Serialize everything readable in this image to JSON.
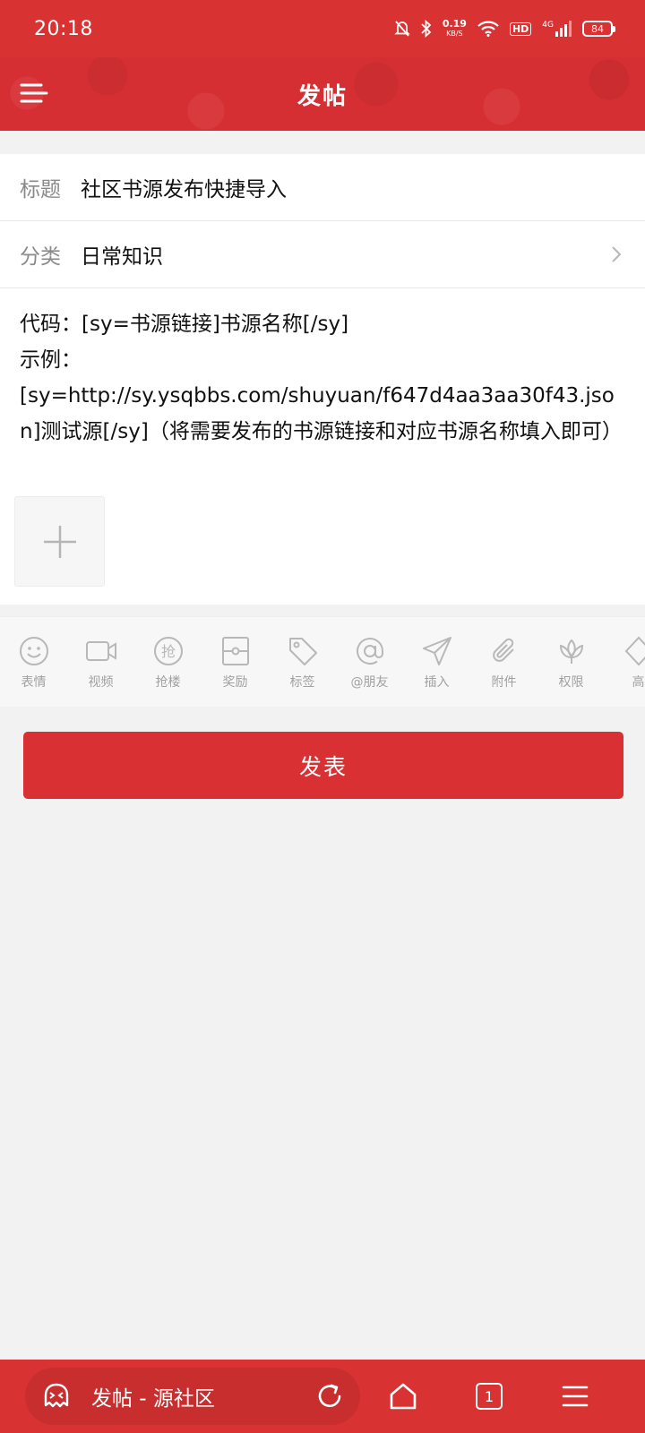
{
  "status_bar": {
    "time": "20:18",
    "net_speed": "0.19",
    "net_unit": "KB/S",
    "hd_label": "HD",
    "signal_label": "4G",
    "battery": "84"
  },
  "header": {
    "title": "发帖"
  },
  "form": {
    "title_label": "标题",
    "title_value": "社区书源发布快捷导入",
    "category_label": "分类",
    "category_value": "日常知识",
    "content": "代码：[sy=书源链接]书源名称[/sy]\n示例：\n[sy=http://sy.ysqbbs.com/shuyuan/f647d4aa3aa30f43.json]测试源[/sy]（将需要发布的书源链接和对应书源名称填入即可）"
  },
  "toolbar": {
    "items": [
      {
        "label": "表情",
        "icon": "smile-icon"
      },
      {
        "label": "视频",
        "icon": "video-icon"
      },
      {
        "label": "抢楼",
        "icon": "grab-floor-icon"
      },
      {
        "label": "奖励",
        "icon": "reward-icon"
      },
      {
        "label": "标签",
        "icon": "tag-icon"
      },
      {
        "label": "@朋友",
        "icon": "at-icon"
      },
      {
        "label": "插入",
        "icon": "send-icon"
      },
      {
        "label": "附件",
        "icon": "paperclip-icon"
      },
      {
        "label": "权限",
        "icon": "lotus-icon"
      },
      {
        "label": "高",
        "icon": "diamond-icon"
      }
    ]
  },
  "publish": {
    "label": "发表"
  },
  "bottom_nav": {
    "page_title": "发帖 - 源社区",
    "tabs_count": "1"
  },
  "colors": {
    "brand_red": "#d93232",
    "button_red": "#d93033",
    "background": "#f2f2f2"
  }
}
